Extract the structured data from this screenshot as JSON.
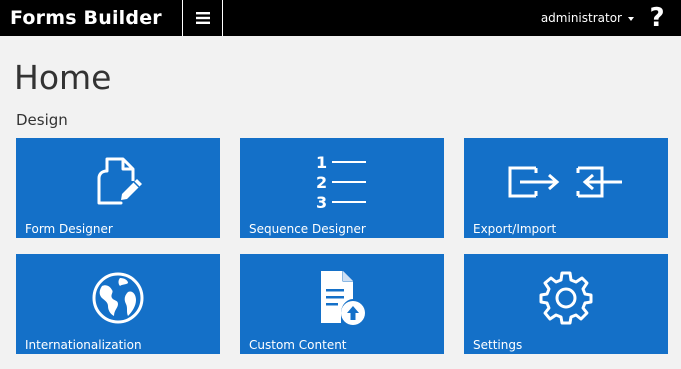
{
  "app": {
    "title": "Forms Builder",
    "menu_icon": "hamburger-menu-icon",
    "user": "administrator",
    "help_label": "?"
  },
  "page": {
    "title": "Home",
    "section": "Design"
  },
  "colors": {
    "topbar": "#000000",
    "tile": "#1470c8",
    "background": "#f2f2f2"
  },
  "tiles": [
    {
      "label": "Form Designer",
      "icon": "form-document-pencil-icon"
    },
    {
      "label": "Sequence Designer",
      "icon": "numbered-list-icon",
      "numbers": [
        "1",
        "2",
        "3"
      ]
    },
    {
      "label": "Export/Import",
      "icon": "export-import-icon"
    },
    {
      "label": "Internationalization",
      "icon": "globe-icon"
    },
    {
      "label": "Custom Content",
      "icon": "document-upload-icon"
    },
    {
      "label": "Settings",
      "icon": "gear-icon"
    }
  ]
}
